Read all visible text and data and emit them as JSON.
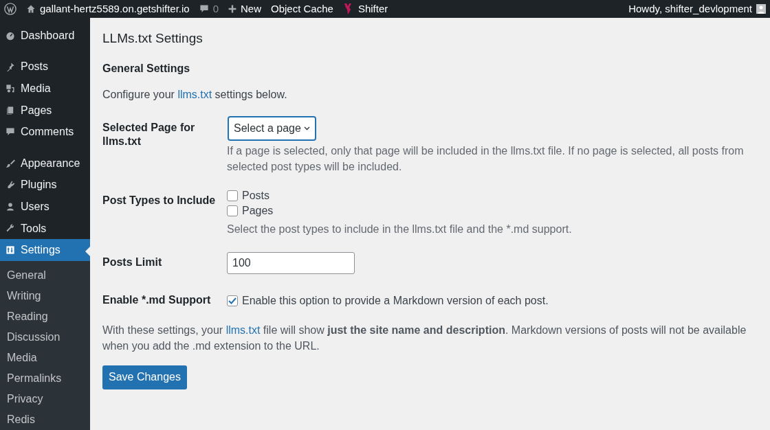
{
  "admin_bar": {
    "site": "gallant-hertz5589.on.getshifter.io",
    "comments": "0",
    "new": "New",
    "object_cache": "Object Cache",
    "shifter": "Shifter",
    "howdy": "Howdy, shifter_devlopment"
  },
  "sidebar": {
    "items": [
      {
        "label": "Dashboard",
        "selected": false
      },
      {
        "label": "Posts",
        "selected": false
      },
      {
        "label": "Media",
        "selected": false
      },
      {
        "label": "Pages",
        "selected": false
      },
      {
        "label": "Comments",
        "selected": false
      },
      {
        "label": "Appearance",
        "selected": false
      },
      {
        "label": "Plugins",
        "selected": false
      },
      {
        "label": "Users",
        "selected": false
      },
      {
        "label": "Tools",
        "selected": false
      },
      {
        "label": "Settings",
        "selected": true
      }
    ],
    "submenu": [
      "General",
      "Writing",
      "Reading",
      "Discussion",
      "Media",
      "Permalinks",
      "Privacy",
      "Redis"
    ]
  },
  "page": {
    "title": "LLMs.txt Settings",
    "section": "General Settings",
    "intro": [
      {
        "kind": "text",
        "text": "Configure your "
      },
      {
        "kind": "link",
        "text": "llms.txt"
      },
      {
        "kind": "text",
        "text": " settings below."
      }
    ],
    "fields": [
      {
        "kind": "select",
        "label": "Selected Page for llms.txt",
        "value": "Select a page",
        "description": "If a page is selected, only that page will be included in the llms.txt file. If no page is selected, all posts from selected post types will be included."
      },
      {
        "kind": "checkboxes",
        "label": "Post Types to Include",
        "options": [
          {
            "label": "Posts",
            "checked": false
          },
          {
            "label": "Pages",
            "checked": false
          }
        ],
        "description": "Select the post types to include in the llms.txt file and the *.md support."
      },
      {
        "kind": "text",
        "label": "Posts Limit",
        "value": "100"
      },
      {
        "kind": "checkboxes",
        "label": "Enable *.md Support",
        "options": [
          {
            "label": "Enable this option to provide a Markdown version of each post.",
            "checked": true
          }
        ]
      }
    ],
    "note": [
      {
        "kind": "text",
        "text": "With these settings, your "
      },
      {
        "kind": "link",
        "text": "llms.txt"
      },
      {
        "kind": "text",
        "text": " file will show **just the site name and description**. Markdown versions of posts will not be available when you add the .md extension to the URL."
      }
    ],
    "save": "Save Changes"
  }
}
